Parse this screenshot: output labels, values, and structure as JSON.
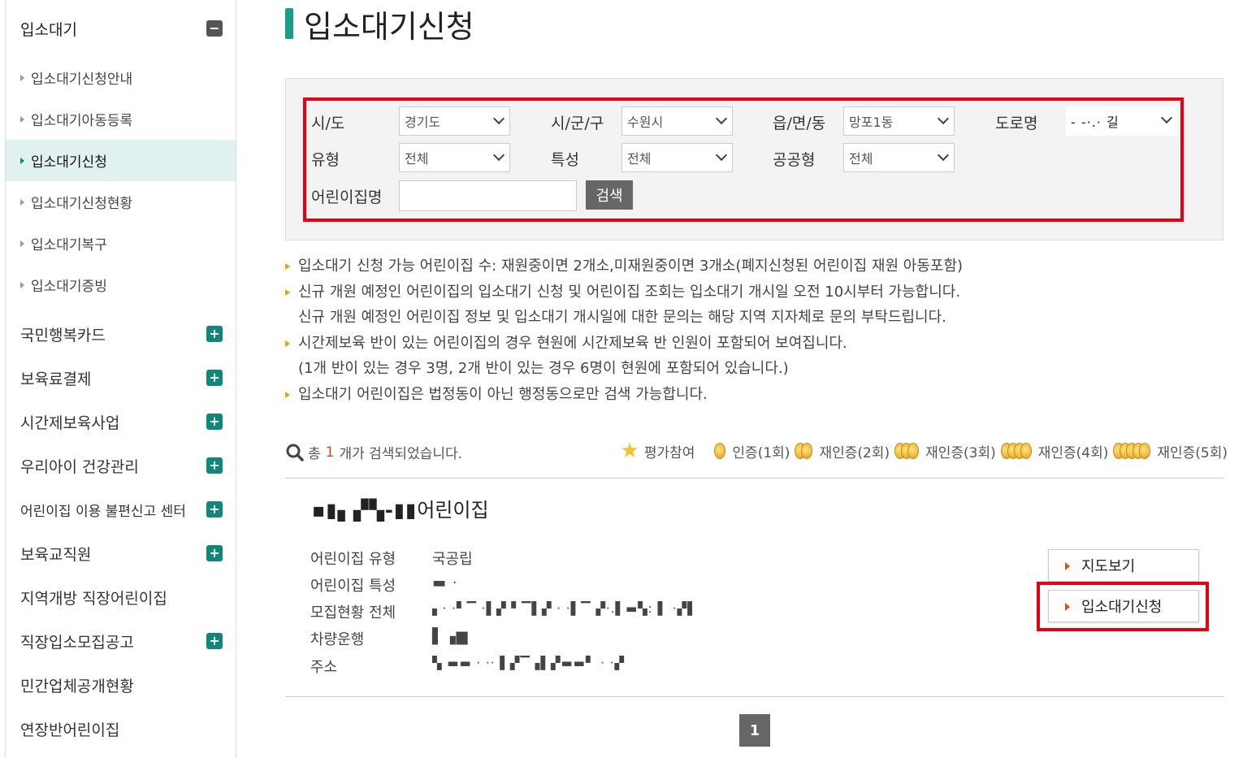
{
  "sidebar": {
    "header": "입소대기",
    "sub_items": [
      {
        "label": "입소대기신청안내"
      },
      {
        "label": "입소대기아동등록"
      },
      {
        "label": "입소대기신청"
      },
      {
        "label": "입소대기신청현황"
      },
      {
        "label": "입소대기복구"
      },
      {
        "label": "입소대기증빙"
      }
    ],
    "categories": [
      {
        "label": "국민행복카드"
      },
      {
        "label": "보육료결제"
      },
      {
        "label": "시간제보육사업"
      },
      {
        "label": "우리아이 건강관리"
      },
      {
        "label": "어린이집 이용 불편신고 센터"
      },
      {
        "label": "보육교직원"
      },
      {
        "label": "지역개방 직장어린이집"
      },
      {
        "label": "직장입소모집공고"
      },
      {
        "label": "민간업체공개현황"
      },
      {
        "label": "연장반어린이집"
      }
    ]
  },
  "page_title": "입소대기신청",
  "filters": {
    "sido_label": "시/도",
    "sido_value": "경기도",
    "sigungu_label": "시/군/구",
    "sigungu_value": "수원시",
    "eup_label": "읍/면/동",
    "eup_value": "망포1동",
    "road_label": "도로명",
    "road_value": "- -·.· 길",
    "type_label": "유형",
    "type_value": "전체",
    "feature_label": "특성",
    "feature_value": "전체",
    "public_label": "공공형",
    "public_value": "전체",
    "name_label": "어린이집명",
    "name_value": "",
    "search_button": "검색"
  },
  "notes": [
    "입소대기 신청 가능 어린이집 수: 재원중이면 2개소,미재원중이면 3개소(폐지신청된 어린이집 재원 아동포함)",
    "신규 개원 예정인 어린이집의 입소대기 신청 및 어린이집 조회는 입소대기 개시일 오전 10시부터 가능합니다.",
    "신규 개원 예정인 어린이집 정보 및 입소대기 개시일에 대한 문의는 해당 지역 지자체로 문의 부탁드립니다.",
    "시간제보육 반이 있는 어린이집의 경우 현원에 시간제보육 반 인원이 포함되어 보여집니다.",
    "(1개 반이 있는 경우 3명, 2개 반이 있는 경우 6명이 현원에 포함되어 있습니다.)",
    "입소대기 어린이집은 법정동이 아닌 행정동으로만 검색 가능합니다."
  ],
  "result": {
    "prefix": "총",
    "count": "1",
    "suffix": "개가 검색되었습니다."
  },
  "legend": {
    "eval": "평가참여",
    "cert1": "인증(1회)",
    "cert2": "재인증(2회)",
    "cert3": "재인증(3회)",
    "cert4": "재인증(4회)",
    "cert5": "재인증(5회)"
  },
  "center": {
    "name_masked": "▪▮▖▞▚-▮▮",
    "name_suffix": "어린이집",
    "type_label": "어린이집 유형",
    "type_value": "국공립",
    "feature_label": "어린이집 특성",
    "feature_value": "▬ ·",
    "recruit_label": "모집현황 전체",
    "recruit_value": "▖·  ·▘▔  ·▌▞  ▘▔▌▞  ·  ·▌▔  ▞·.▌▬▚: ▌ ·▞▌",
    "vehicle_label": "차량운행",
    "vehicle_value": "▌▗▆",
    "address_label": "주소",
    "address_value": "▚ ▬▬ · ·· ▌▞▔▗▌▞▬▬▘ · ·▞",
    "map_button": "지도보기",
    "apply_button": "입소대기신청"
  },
  "pagination": {
    "current": "1"
  }
}
